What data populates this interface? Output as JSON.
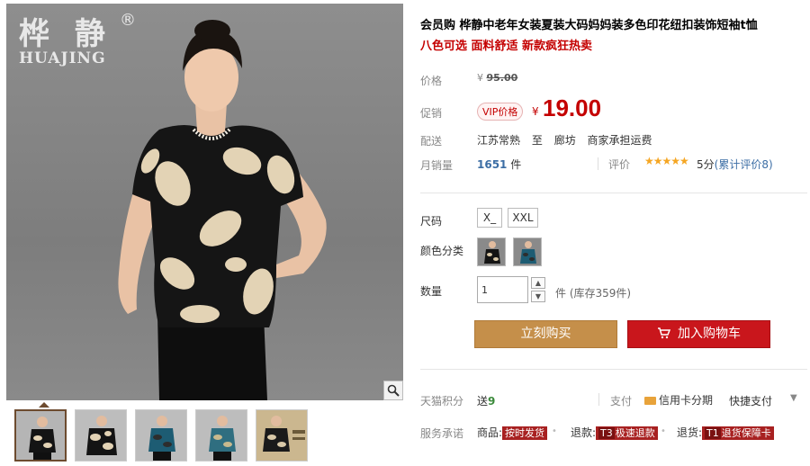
{
  "gallery": {
    "brand_cn": "桦 静",
    "brand_reg": "®",
    "brand_en": "HUAJING",
    "zoom_icon": "magnifier-icon",
    "thumbnails": [
      {
        "colors": [
          "#141414",
          "#e3d3b5"
        ],
        "active": true
      },
      {
        "colors": [
          "#141414",
          "#e3d3b5"
        ],
        "active": false
      },
      {
        "colors": [
          "#1d5c73",
          "#2d2d2d"
        ],
        "active": false
      },
      {
        "colors": [
          "#2f6e80",
          "#c8b98e"
        ],
        "active": false
      },
      {
        "colors": [
          "#1a1a1a",
          "#d9c9a8"
        ],
        "active": false
      }
    ]
  },
  "product": {
    "title": "会员购 桦静中老年女装夏装大码妈妈装多色印花纽扣装饰短袖t恤",
    "subtitle": "八色可选 面料舒适 新款疯狂热卖",
    "price_label": "价格",
    "original_price_symbol": "¥",
    "original_price": "95.00",
    "promo_label": "促销",
    "vip_tag": "VIP价格",
    "promo_price_symbol": "¥",
    "promo_price": "19.00",
    "ship_label": "配送",
    "ship_from": "江苏常熟",
    "ship_to_word": "至",
    "ship_to": "廊坊",
    "ship_fee": "商家承担运费",
    "sales_label": "月销量",
    "sales_count": "1651",
    "sales_unit": "件",
    "rating_label": "评价",
    "stars": "★★★★★",
    "rating_score": "5分",
    "rating_count": "(累计评价8)"
  },
  "options": {
    "size_label": "尺码",
    "sizes": [
      "X_",
      "XXL"
    ],
    "color_label": "颜色分类",
    "color_swatches": [
      {
        "colors": [
          "#141414",
          "#d9c9a8"
        ]
      },
      {
        "colors": [
          "#1d5c73",
          "#2d2d2d"
        ]
      }
    ],
    "qty_label": "数量",
    "qty_value": "1",
    "qty_up_icon": "chevron-up-icon",
    "qty_down_icon": "chevron-down-icon",
    "stock_text": "件 (库存359件)"
  },
  "actions": {
    "buy_now": "立刻购买",
    "add_cart": "加入购物车",
    "cart_icon": "cart-icon"
  },
  "extra": {
    "points_label": "天猫积分",
    "points_prefix": "送",
    "points_value": "9",
    "pay_label": "支付",
    "pay_card": "信用卡分期",
    "pay_quick": "快捷支付",
    "pay_arrow": "▼",
    "service_label": "服务承诺",
    "svc1_prefix": "商品:",
    "svc1_badge": "按时发货",
    "svc2_prefix": "退款:",
    "svc2_tag": "T3",
    "svc2_badge": "极速退款",
    "svc3_prefix": "退货:",
    "svc3_tag": "T1",
    "svc3_badge": "退货保障卡"
  },
  "colors": {
    "accent_red": "#c40000",
    "buy_button": "#c58f4a",
    "cart_button": "#c9161c",
    "link_blue": "#3c6ea5",
    "star_orange": "#f5a623"
  }
}
